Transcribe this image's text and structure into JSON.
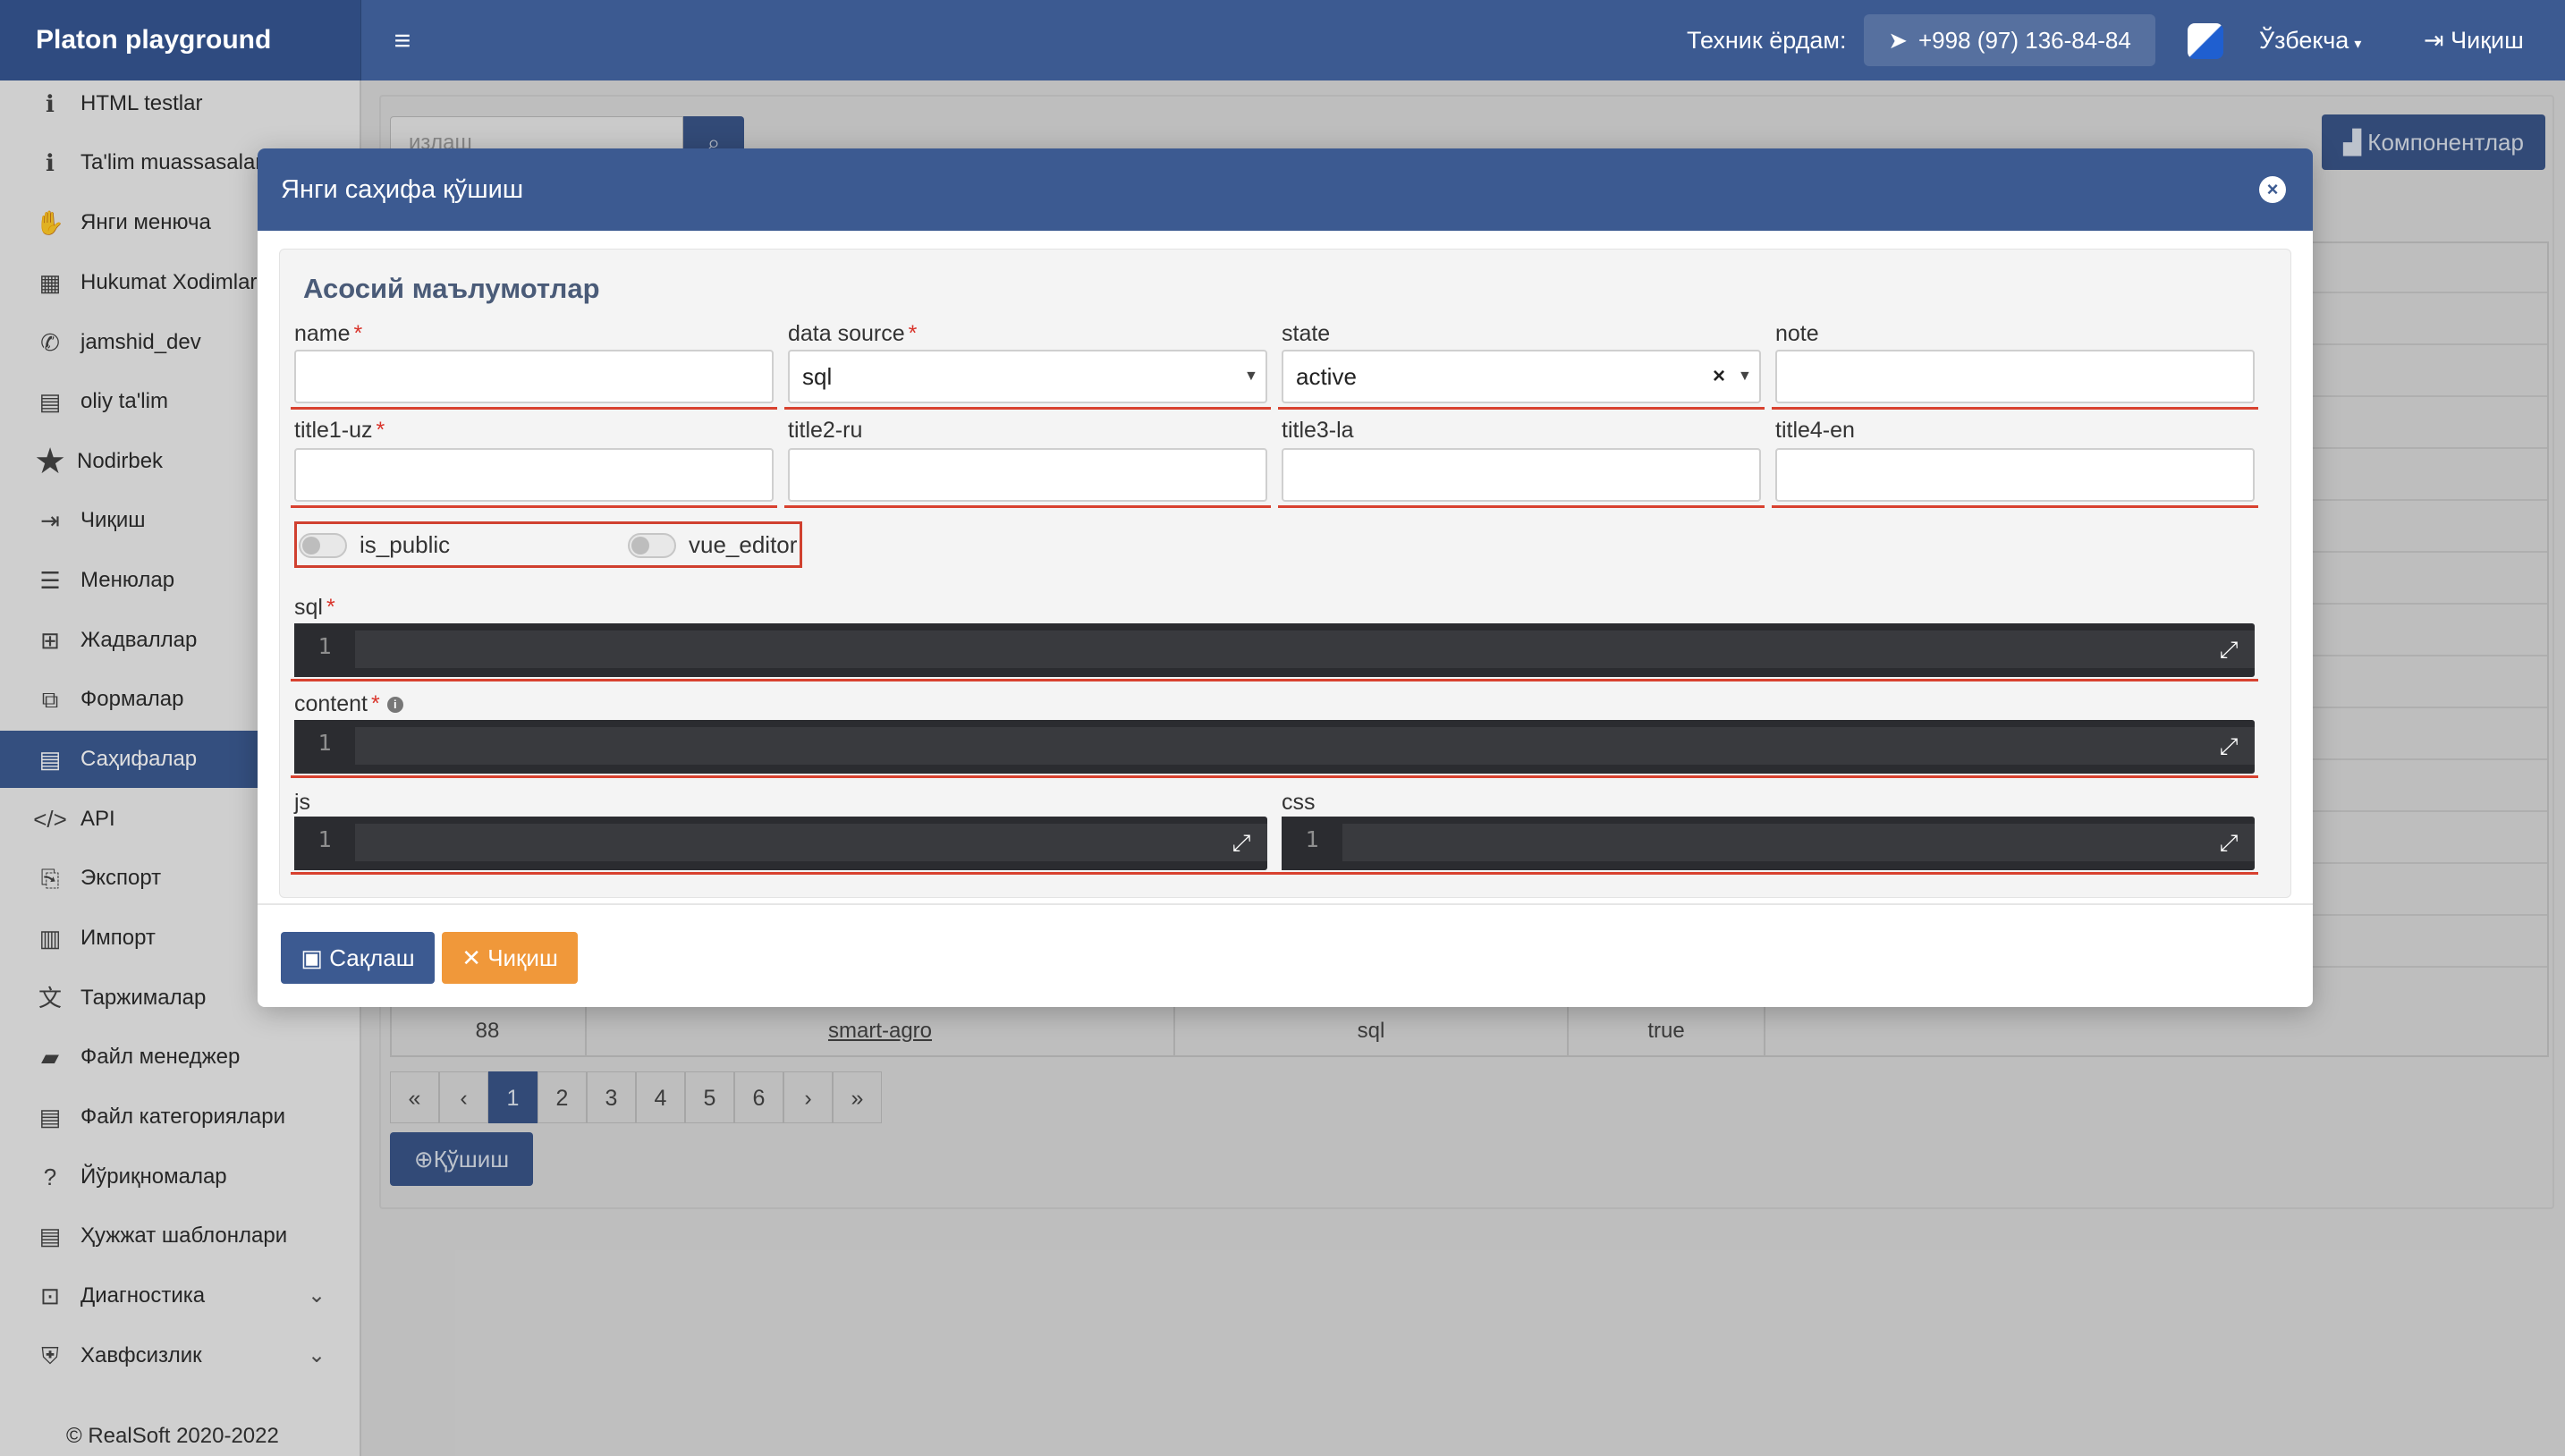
{
  "navbar": {
    "brand": "Platon playground",
    "support_label": "Техник ёрдам:",
    "phone": "+998 (97) 136-84-84",
    "language": "Ўзбекча",
    "exit": "Чиқиш"
  },
  "sidebar": {
    "items": [
      {
        "label": "HTML testlar",
        "icon": "info-icon"
      },
      {
        "label": "Ta'lim muassasalari",
        "icon": "info-icon"
      },
      {
        "label": "Янги менюча",
        "icon": "hand-icon"
      },
      {
        "label": "Hukumat Xodimlari",
        "icon": "building-icon"
      },
      {
        "label": "jamshid_dev",
        "icon": "phone-icon"
      },
      {
        "label": "oliy ta'lim",
        "icon": "document-icon"
      },
      {
        "label": "Nodirbek",
        "icon": "star-icon"
      },
      {
        "label": "Чиқиш",
        "icon": "sign-out-icon"
      },
      {
        "label": "Менюлар",
        "icon": "list-icon"
      },
      {
        "label": "Жадваллар",
        "icon": "table-icon"
      },
      {
        "label": "Формалар",
        "icon": "form-icon"
      },
      {
        "label": "Саҳифалар",
        "icon": "pages-icon"
      },
      {
        "label": "API",
        "icon": "code-icon"
      },
      {
        "label": "Экспорт",
        "icon": "export-icon"
      },
      {
        "label": "Импорт",
        "icon": "import-icon"
      },
      {
        "label": "Таржималар",
        "icon": "translate-icon"
      },
      {
        "label": "Файл менеджер",
        "icon": "folder-icon"
      },
      {
        "label": "Файл категориялари",
        "icon": "file-icon"
      },
      {
        "label": "Йўриқномалар",
        "icon": "help-icon"
      },
      {
        "label": "Ҳужжат шаблонлари",
        "icon": "template-icon"
      },
      {
        "label": "Диагностика",
        "icon": "monitor-icon"
      },
      {
        "label": "Хавфсизлик",
        "icon": "shield-icon"
      }
    ],
    "copyright": "© RealSoft 2020-2022"
  },
  "background": {
    "search_placeholder": "излаш",
    "components_button": "Компонентлар",
    "last_row": {
      "id": "88",
      "name": "smart-agro",
      "source": "sql",
      "public": "true"
    },
    "pages": [
      "«",
      "‹",
      "1",
      "2",
      "3",
      "4",
      "5",
      "6",
      "›",
      "»"
    ],
    "active_page": "1",
    "add_button": "Қўшиш"
  },
  "modal": {
    "title": "Янги саҳифа қўшиш",
    "section_title": "Асосий маълумотлар",
    "fields": {
      "name": {
        "label": "name",
        "value": ""
      },
      "data_source": {
        "label": "data source",
        "value": "sql"
      },
      "state": {
        "label": "state",
        "value": "active"
      },
      "note": {
        "label": "note",
        "value": ""
      },
      "title1": {
        "label": "title1-uz",
        "value": ""
      },
      "title2": {
        "label": "title2-ru",
        "value": ""
      },
      "title3": {
        "label": "title3-la",
        "value": ""
      },
      "title4": {
        "label": "title4-en",
        "value": ""
      }
    },
    "toggles": {
      "is_public": {
        "label": "is_public",
        "on": false
      },
      "vue_editor": {
        "label": "vue_editor",
        "on": false
      }
    },
    "editors": {
      "sql": {
        "label": "sql",
        "line": "1"
      },
      "content": {
        "label": "content",
        "line": "1"
      },
      "js": {
        "label": "js",
        "line": "1"
      },
      "css": {
        "label": "css",
        "line": "1"
      }
    },
    "save_button": "Сақлаш",
    "exit_button": "Чиқиш"
  },
  "colors": {
    "primary": "#3c5a91",
    "warning": "#f0983a",
    "error_underline": "#d8412f",
    "editor_bg": "#2b2c30"
  }
}
